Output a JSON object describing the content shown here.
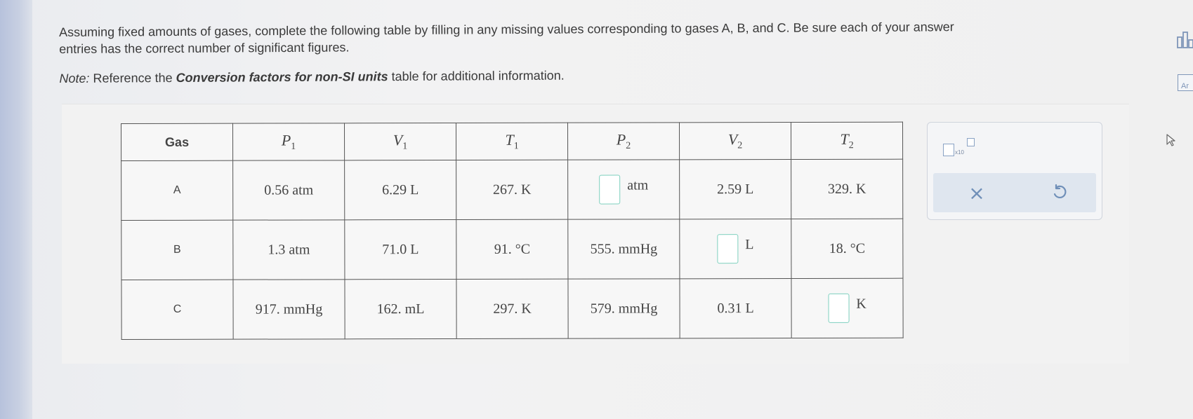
{
  "instructions": {
    "line1": "Assuming fixed amounts of gases, complete the following table by filling in any missing values corresponding to gases A, B, and C. Be sure each of your answer",
    "line2": "entries has the correct number of significant figures.",
    "note_label": "Note:",
    "note_pre": " Reference the ",
    "note_bold": "Conversion factors for non-SI units",
    "note_post": " table for additional information."
  },
  "table": {
    "headers": {
      "gas": "Gas",
      "p1": "P",
      "p1_sub": "1",
      "v1": "V",
      "v1_sub": "1",
      "t1": "T",
      "t1_sub": "1",
      "p2": "P",
      "p2_sub": "2",
      "v2": "V",
      "v2_sub": "2",
      "t2": "T",
      "t2_sub": "2"
    },
    "rows": [
      {
        "gas": "A",
        "p1": "0.56 atm",
        "v1": "6.29 L",
        "t1": "267. K",
        "p2_unit": "atm",
        "v2": "2.59 L",
        "t2": "329. K"
      },
      {
        "gas": "B",
        "p1": "1.3 atm",
        "v1": "71.0 L",
        "t1": "91. °C",
        "p2": "555. mmHg",
        "v2_unit": "L",
        "t2": "18. °C"
      },
      {
        "gas": "C",
        "p1": "917. mmHg",
        "v1": "162. mL",
        "t1": "297. K",
        "p2": "579. mmHg",
        "v2": "0.31 L",
        "t2_unit": "K"
      }
    ]
  },
  "tool_panel": {
    "sci_notation_label": "x10",
    "clear_icon": "close-icon",
    "undo_icon": "undo-icon"
  },
  "sidebar": {
    "bars_icon": "bar-chart-icon",
    "ar_label": "Ar"
  },
  "colors": {
    "accent": "#6f8fb8",
    "answer_box_border": "#7ed0be"
  }
}
